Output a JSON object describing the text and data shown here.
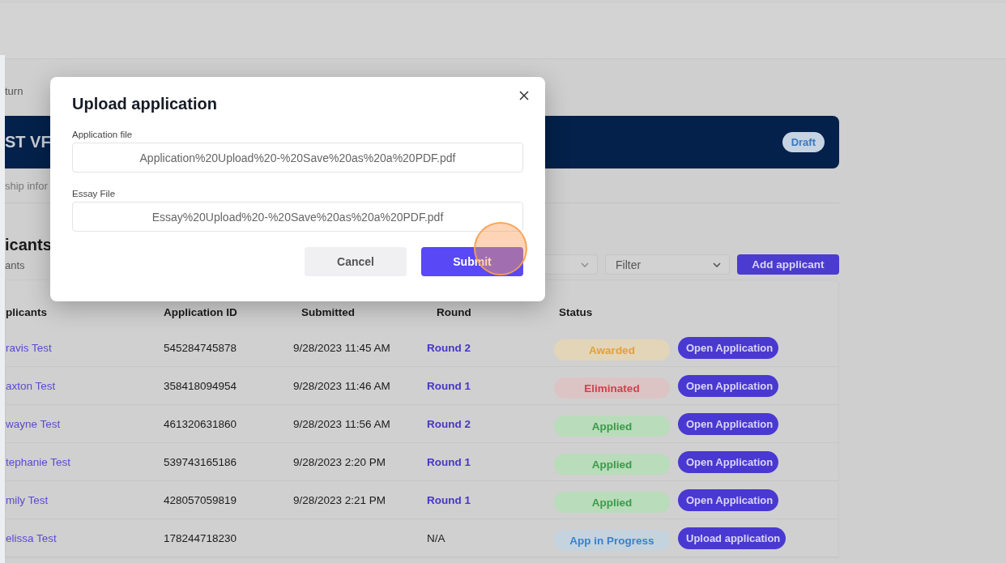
{
  "breadcrumb": "turn",
  "banner": {
    "title": "ST VF",
    "badge": "Draft"
  },
  "tab": "ship infor",
  "section": {
    "title": "icants",
    "subtitle": "ants"
  },
  "filters": {
    "filter_placeholder": "Filter",
    "add_button": "Add applicant"
  },
  "table": {
    "columns": [
      "plicants",
      "Application ID",
      "Submitted",
      "Round",
      "Status"
    ],
    "rows": [
      {
        "name": "ravis Test",
        "id": "545284745878",
        "submitted": "9/28/2023 11:45 AM",
        "round": {
          "text": "Round 2",
          "kind": "link"
        },
        "status": {
          "text": "Awarded",
          "kind": "awarded"
        },
        "action": "Open Application"
      },
      {
        "name": "axton Test",
        "id": "358418094954",
        "submitted": "9/28/2023 11:46 AM",
        "round": {
          "text": "Round 1",
          "kind": "link"
        },
        "status": {
          "text": "Eliminated",
          "kind": "eliminated"
        },
        "action": "Open Application"
      },
      {
        "name": "wayne Test",
        "id": "461320631860",
        "submitted": "9/28/2023 11:56 AM",
        "round": {
          "text": "Round 2",
          "kind": "link"
        },
        "status": {
          "text": "Applied",
          "kind": "applied"
        },
        "action": "Open Application"
      },
      {
        "name": "tephanie Test",
        "id": "539743165186",
        "submitted": "9/28/2023 2:20 PM",
        "round": {
          "text": "Round 1",
          "kind": "link"
        },
        "status": {
          "text": "Applied",
          "kind": "applied"
        },
        "action": "Open Application"
      },
      {
        "name": "mily Test",
        "id": "428057059819",
        "submitted": "9/28/2023 2:21 PM",
        "round": {
          "text": "Round 1",
          "kind": "link"
        },
        "status": {
          "text": "Applied",
          "kind": "applied"
        },
        "action": "Open Application"
      },
      {
        "name": "elissa Test",
        "id": "178244718230",
        "round": {
          "text": "N/A",
          "kind": "plain"
        },
        "status": {
          "text": "App in Progress",
          "kind": "progress"
        },
        "action": "Upload application"
      }
    ]
  },
  "modal": {
    "title": "Upload application",
    "fields": [
      {
        "label": "Application file",
        "value": "Application%20Upload%20-%20Save%20as%20a%20PDF.pdf"
      },
      {
        "label": "Essay File",
        "value": "Essay%20Upload%20-%20Save%20as%20a%20PDF.pdf"
      }
    ],
    "cancel": "Cancel",
    "submit": "Submit"
  }
}
